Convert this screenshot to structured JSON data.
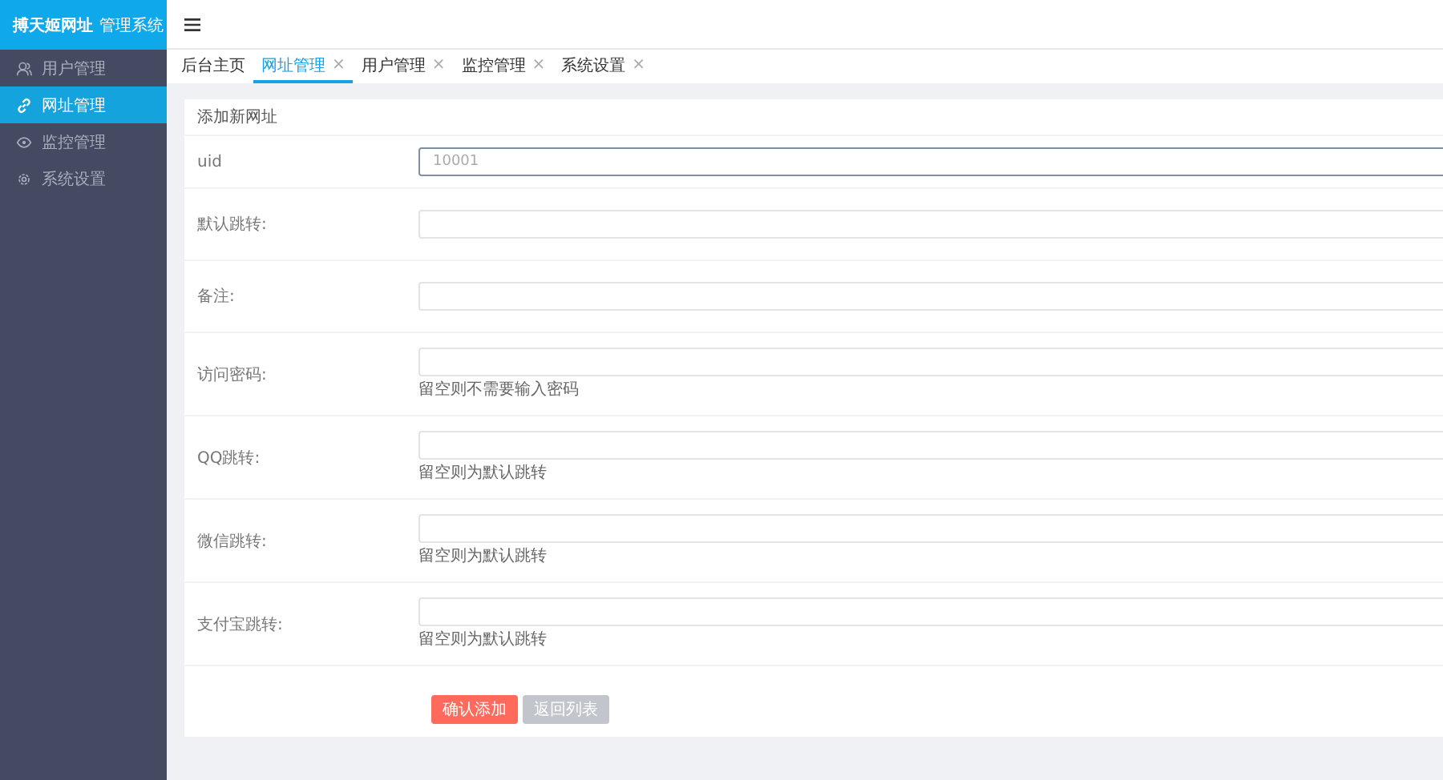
{
  "logo": {
    "name": "搏天姬网址",
    "suffix": "管理系统"
  },
  "sidebar": {
    "items": [
      {
        "label": "用户管理",
        "selected": false
      },
      {
        "label": "网址管理",
        "selected": true
      },
      {
        "label": "监控管理",
        "selected": false
      },
      {
        "label": "系统设置",
        "selected": false
      }
    ]
  },
  "tabs": [
    {
      "label": "后台主页",
      "selected": false
    },
    {
      "label": "网址管理",
      "close": "×",
      "selected": true
    },
    {
      "label": "用户管理",
      "close": "×",
      "selected": false
    },
    {
      "label": "监控管理",
      "close": "×",
      "selected": false
    },
    {
      "label": "系统设置",
      "close": "×",
      "selected": false
    }
  ],
  "form": {
    "title": "添加新网址",
    "fields": [
      {
        "label": "uid",
        "value": "10001",
        "focused": true
      },
      {
        "label": "默认跳转:",
        "focused": false
      },
      {
        "label": "备注:",
        "focused": false
      },
      {
        "label": "访问密码:",
        "hint": "留空则不需要输入密码",
        "focused": false
      },
      {
        "label": "QQ跳转:",
        "hint": "留空则为默认跳转",
        "focused": false
      },
      {
        "label": "微信跳转:",
        "hint": "留空则为默认跳转",
        "focused": false
      },
      {
        "label": "支付宝跳转:",
        "hint": "留空则为默认跳转",
        "focused": false
      }
    ],
    "buttons": [
      {
        "label": "确认添加",
        "kind": "primary"
      },
      {
        "label": "返回列表",
        "kind": "secondary"
      }
    ]
  }
}
